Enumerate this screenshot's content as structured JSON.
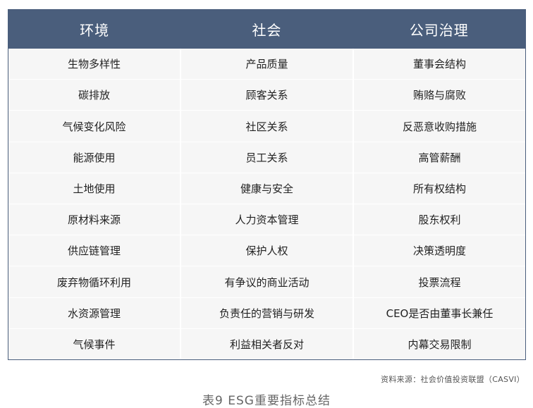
{
  "table": {
    "headers": [
      "环境",
      "社会",
      "公司治理"
    ],
    "rows": [
      [
        "生物多样性",
        "产品质量",
        "董事会结构"
      ],
      [
        "碳排放",
        "顾客关系",
        "贿赂与腐败"
      ],
      [
        "气候变化风险",
        "社区关系",
        "反恶意收购措施"
      ],
      [
        "能源使用",
        "员工关系",
        "高管薪酬"
      ],
      [
        "土地使用",
        "健康与安全",
        "所有权结构"
      ],
      [
        "原材料来源",
        "人力资本管理",
        "股东权利"
      ],
      [
        "供应链管理",
        "保护人权",
        "决策透明度"
      ],
      [
        "废弃物循环利用",
        "有争议的商业活动",
        "投票流程"
      ],
      [
        "水资源管理",
        "负责任的营销与研发",
        "CEO是否由董事长兼任"
      ],
      [
        "气候事件",
        "利益相关者反对",
        "内幕交易限制"
      ]
    ]
  },
  "source": "资料来源：社会价值投资联盟（CASVI）",
  "caption": "表9  ESG重要指标总结",
  "colors": {
    "header_bg": "#4a5e7c",
    "header_text": "#ffffff",
    "cell_bg": "#f6f6f6",
    "cell_text": "#222222"
  }
}
